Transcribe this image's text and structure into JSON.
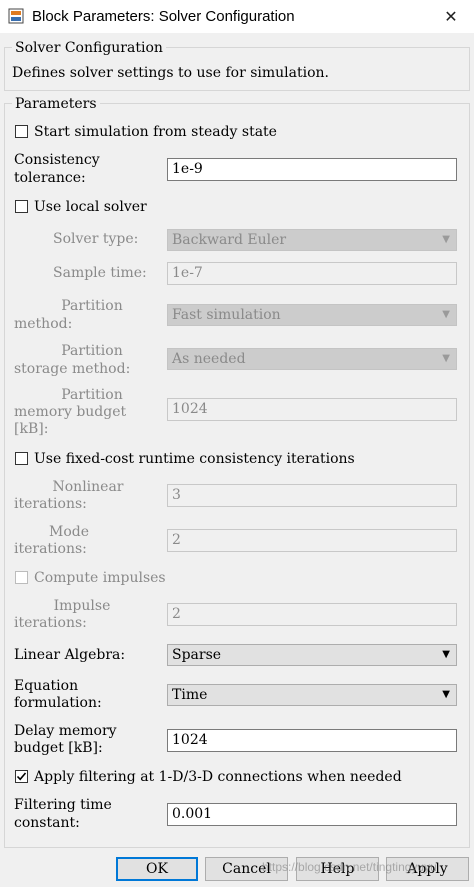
{
  "window": {
    "title": "Block Parameters: Solver Configuration",
    "close_glyph": "✕"
  },
  "description_group": {
    "legend": "Solver Configuration",
    "text": "Defines solver settings to use for simulation."
  },
  "parameters": {
    "legend": "Parameters",
    "start_steady_state": {
      "label": "Start simulation from steady state",
      "checked": false
    },
    "consistency_tolerance": {
      "label_line1": "Consistency",
      "label_line2": "tolerance:",
      "value": "1e-9"
    },
    "use_local_solver": {
      "label": "Use local solver",
      "checked": false
    },
    "solver_type": {
      "label": "Solver type:",
      "value": "Backward Euler"
    },
    "sample_time": {
      "label": "Sample time:",
      "value": "1e-7"
    },
    "partition_method": {
      "label_line1": "Partition",
      "label_line2": "method:",
      "value": "Fast simulation"
    },
    "partition_storage": {
      "label_line1": "Partition",
      "label_line2": "storage method:",
      "value": "As needed"
    },
    "partition_memory": {
      "label_line1": "Partition",
      "label_line2": "memory budget",
      "label_line3": "[kB]:",
      "value": "1024"
    },
    "fixed_cost": {
      "label": "Use fixed-cost runtime consistency iterations",
      "checked": false
    },
    "nonlinear_iterations": {
      "label_line1": "Nonlinear",
      "label_line2": "iterations:",
      "value": "3"
    },
    "mode_iterations": {
      "label_line1": "Mode",
      "label_line2": "iterations:",
      "value": "2"
    },
    "compute_impulses": {
      "label": "Compute impulses",
      "checked": false
    },
    "impulse_iterations": {
      "label_line1": "Impulse",
      "label_line2": "iterations:",
      "value": "2"
    },
    "linear_algebra": {
      "label": "Linear Algebra:",
      "value": "Sparse"
    },
    "equation_formulation": {
      "label_line1": "Equation",
      "label_line2": "formulation:",
      "value": "Time"
    },
    "delay_memory": {
      "label_line1": "Delay memory",
      "label_line2": "budget [kB]:",
      "value": "1024"
    },
    "apply_filtering": {
      "label": "Apply filtering at 1-D/3-D connections when needed",
      "checked": true
    },
    "filtering_time": {
      "label_line1": "Filtering time",
      "label_line2": "constant:",
      "value": "0.001"
    }
  },
  "buttons": {
    "ok": "OK",
    "cancel": "Cancel",
    "help": "Help",
    "apply": "Apply"
  },
  "watermark": "https://blog.csdn.net/tingtingyuyu",
  "colors": {
    "focus_border": "#0078d7",
    "disabled_text": "#8a8a8a",
    "background": "#f0f0f0"
  }
}
